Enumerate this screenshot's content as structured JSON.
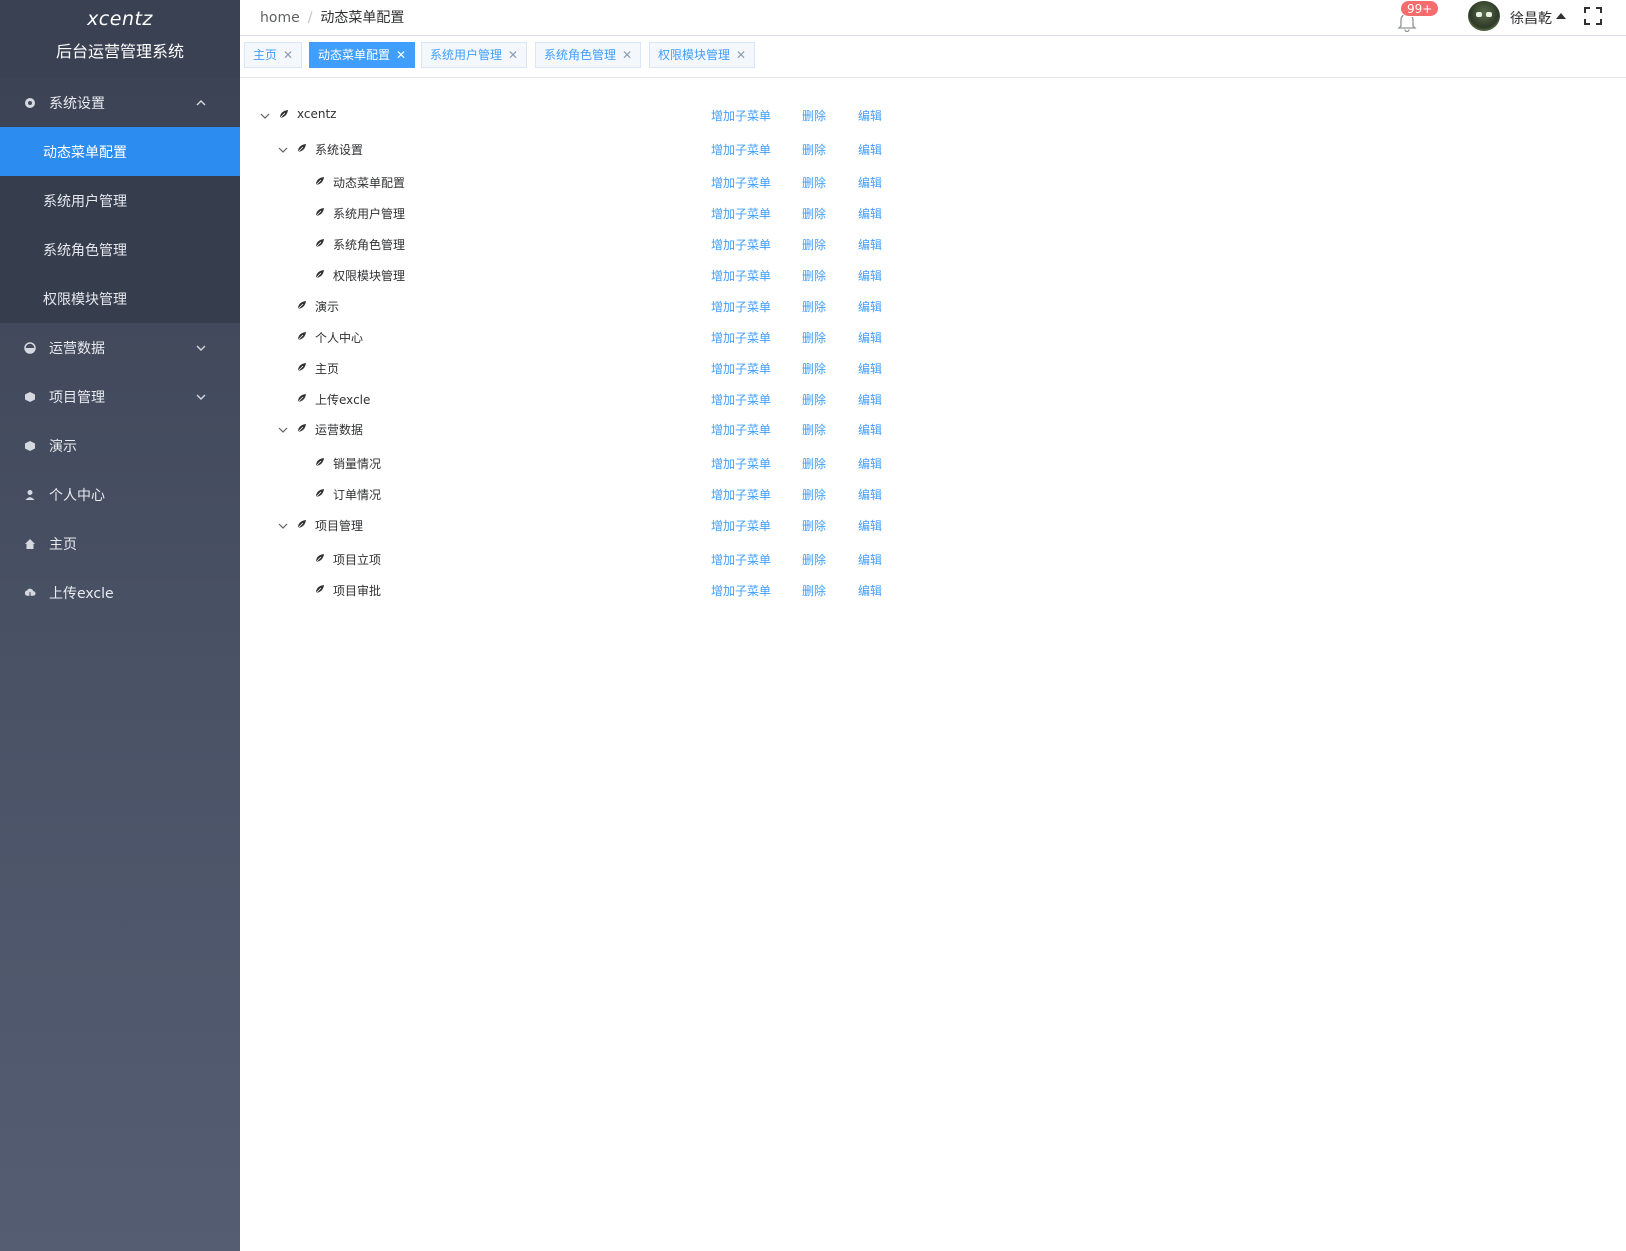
{
  "brand": {
    "name": "xcentz",
    "subtitle": "后台运营管理系统"
  },
  "sidebar": {
    "groups": [
      {
        "label": "系统设置",
        "icon": "gear-icon",
        "expanded": true,
        "items": [
          "动态菜单配置",
          "系统用户管理",
          "系统角色管理",
          "权限模块管理"
        ],
        "active_item": "动态菜单配置"
      },
      {
        "label": "运营数据",
        "icon": "chart-icon",
        "expanded": false
      },
      {
        "label": "项目管理",
        "icon": "cube-icon",
        "expanded": false
      },
      {
        "label": "演示",
        "icon": "cube-icon"
      },
      {
        "label": "个人中心",
        "icon": "user-icon"
      },
      {
        "label": "主页",
        "icon": "home-icon"
      },
      {
        "label": "上传excle",
        "icon": "cloud-upload-icon"
      }
    ]
  },
  "header": {
    "breadcrumb": [
      "home",
      "动态菜单配置"
    ],
    "notification_badge": "99+",
    "username": "徐昌乾"
  },
  "tabs": [
    {
      "label": "主页",
      "active": false
    },
    {
      "label": "动态菜单配置",
      "active": true
    },
    {
      "label": "系统用户管理",
      "active": false
    },
    {
      "label": "系统角色管理",
      "active": false
    },
    {
      "label": "权限模块管理",
      "active": false
    }
  ],
  "tree": {
    "actions": {
      "add_child": "增加子菜单",
      "delete": "删除",
      "edit": "编辑"
    },
    "nodes": [
      {
        "label": "xcentz",
        "level": 0,
        "expandable": true
      },
      {
        "label": "系统设置",
        "level": 1,
        "expandable": true
      },
      {
        "label": "动态菜单配置",
        "level": 2,
        "expandable": false
      },
      {
        "label": "系统用户管理",
        "level": 2,
        "expandable": false
      },
      {
        "label": "系统角色管理",
        "level": 2,
        "expandable": false
      },
      {
        "label": "权限模块管理",
        "level": 2,
        "expandable": false
      },
      {
        "label": "演示",
        "level": 1,
        "expandable": false
      },
      {
        "label": "个人中心",
        "level": 1,
        "expandable": false
      },
      {
        "label": "主页",
        "level": 1,
        "expandable": false
      },
      {
        "label": "上传excle",
        "level": 1,
        "expandable": false
      },
      {
        "label": "运营数据",
        "level": 1,
        "expandable": true
      },
      {
        "label": "销量情况",
        "level": 2,
        "expandable": false
      },
      {
        "label": "订单情况",
        "level": 2,
        "expandable": false
      },
      {
        "label": "项目管理",
        "level": 1,
        "expandable": true
      },
      {
        "label": "项目立项",
        "level": 2,
        "expandable": false
      },
      {
        "label": "项目审批",
        "level": 2,
        "expandable": false
      }
    ]
  },
  "colors": {
    "accent": "#409eff",
    "sidebar_active": "#2d8cf0",
    "badge": "#f56c6c"
  }
}
